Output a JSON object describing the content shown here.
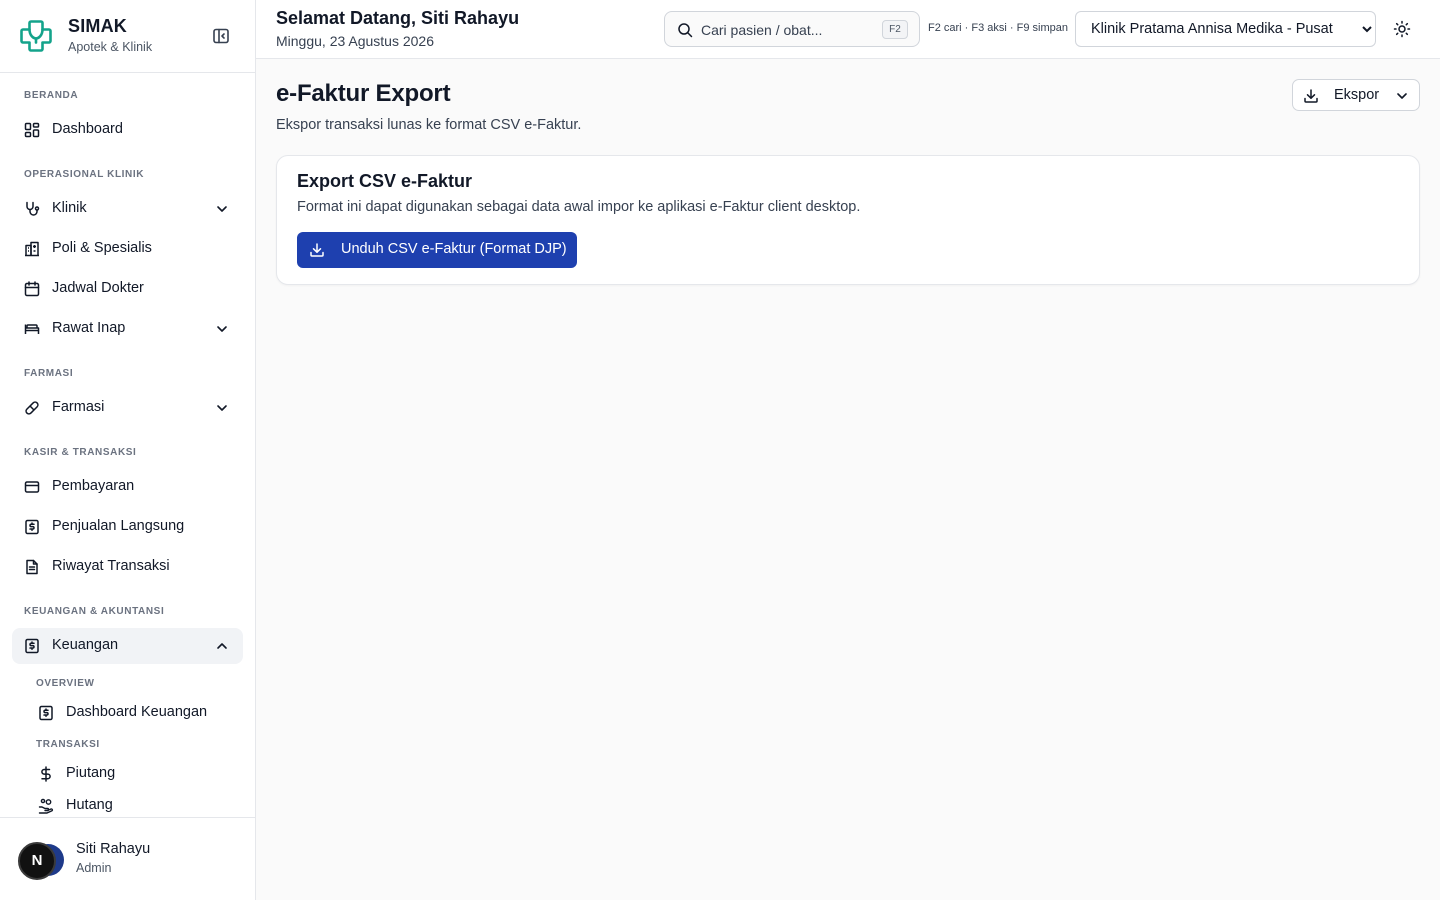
{
  "brand": {
    "title": "SIMAK",
    "subtitle": "Apotek & Klinik"
  },
  "colors": {
    "accent": "#1e40af",
    "logo": "#14a38b",
    "active_bg": "#f1f3f6"
  },
  "sidebar": {
    "sections": {
      "beranda": "BERANDA",
      "operasional": "OPERASIONAL KLINIK",
      "farmasi": "FARMASI",
      "kasir": "KASIR & TRANSAKSI",
      "keuangan": "KEUANGAN & AKUNTANSI"
    },
    "items": {
      "dashboard": "Dashboard",
      "klinik": "Klinik",
      "poli": "Poli & Spesialis",
      "jadwal": "Jadwal Dokter",
      "rawat_inap": "Rawat Inap",
      "farmasi": "Farmasi",
      "pembayaran": "Pembayaran",
      "penjualan": "Penjualan Langsung",
      "riwayat": "Riwayat Transaksi",
      "keuangan": "Keuangan"
    },
    "keuangan_sub": {
      "overview_label": "OVERVIEW",
      "dashboard_keuangan": "Dashboard Keuangan",
      "transaksi_label": "TRANSAKSI",
      "piutang": "Piutang",
      "hutang": "Hutang"
    }
  },
  "user": {
    "initial": "N",
    "name": "Siti Rahayu",
    "role": "Admin"
  },
  "header": {
    "greeting": "Selamat Datang, Siti Rahayu",
    "date": "Minggu, 23 Agustus 2026",
    "search_placeholder": "Cari pasien / obat...",
    "search_kbd": "F2",
    "shortcuts": "F2 cari · F3 aksi · F9 simpan",
    "clinic_selected": "Klinik Pratama Annisa Medika - Pusat"
  },
  "main": {
    "title": "e-Faktur Export",
    "subtitle": "Ekspor transaksi lunas ke format CSV e-Faktur.",
    "export_button": "Ekspor",
    "card": {
      "title": "Export CSV e-Faktur",
      "description": "Format ini dapat digunakan sebagai data awal impor ke aplikasi e-Faktur client desktop.",
      "download_button": "Unduh CSV e-Faktur (Format DJP)"
    }
  }
}
